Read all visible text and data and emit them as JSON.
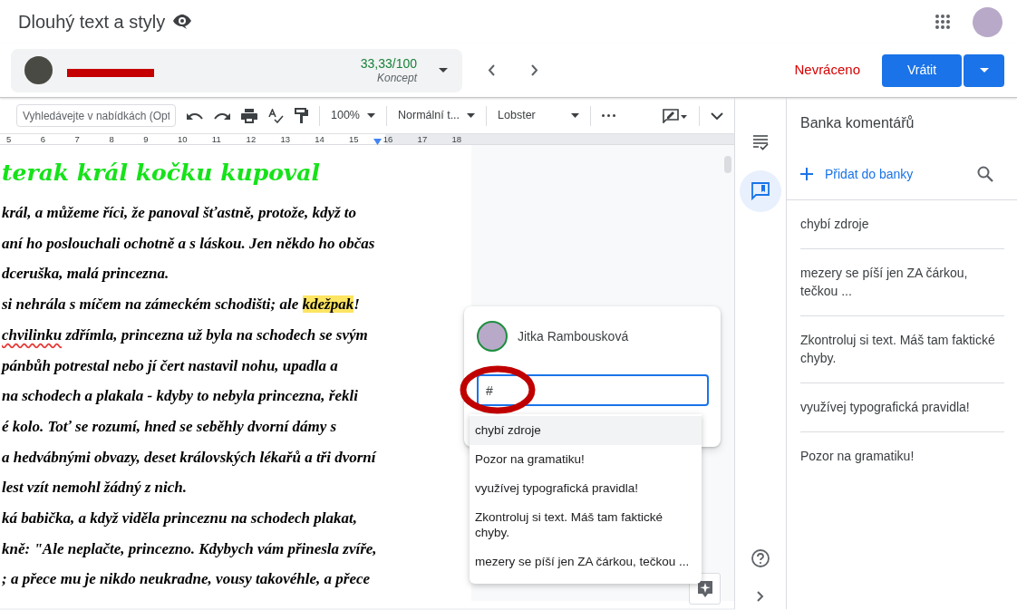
{
  "document": {
    "title": "Dlouhý text a styly"
  },
  "student": {
    "grade": "33,33/100",
    "status": "Koncept"
  },
  "return_status": "Nevráceno",
  "return_button": "Vrátit",
  "toolbar": {
    "search_placeholder": "Vyhledávejte v nabídkách (Opt",
    "zoom": "100%",
    "style": "Normální t...",
    "font": "Lobster"
  },
  "ruler": {
    "labels": [
      "5",
      "6",
      "7",
      "8",
      "9",
      "10",
      "11",
      "12",
      "13",
      "14",
      "15",
      "16",
      "17",
      "18"
    ]
  },
  "doc": {
    "heading": "terak král kočku kupoval",
    "lines": [
      {
        "text": "král, a můžeme říci, že panoval šťastně, protože, když to"
      },
      {
        "text": "aní ho poslouchali ochotně a s láskou. Jen někdo ho občas"
      },
      {
        "text": "dceruška, malá princezna."
      },
      {
        "parts": [
          {
            "text": "si nehrála s míčem na zámeckém schodišti; ale ",
            "highlighted": false
          },
          {
            "text": "kdežpak",
            "highlighted": true
          },
          {
            "text": "!",
            "highlighted": false
          }
        ]
      },
      {
        "parts": [
          {
            "text": "chvilinku",
            "misspelled": true
          },
          {
            "text": " zdřímla, princezna už byla na schodech se svým",
            "misspelled": false
          }
        ]
      },
      {
        "text": "pánbůh potrestal nebo jí čert nastavil nohu, upadla a"
      },
      {
        "text": "na schodech a plakala - kdyby to nebyla princezna, řekli"
      },
      {
        "text": "é kolo. Toť se rozumí, hned se seběhly dvorní dámy s"
      },
      {
        "text": "a hedvábnými obvazy, deset královských lékařů a tři dvorní"
      },
      {
        "text": "lest vzít nemohl žádný z nich."
      },
      {
        "text": "ká babička, a když viděla princeznu na schodech plakat,"
      },
      {
        "text": "kně: \"Ale neplačte, princezno. Kdybych vám přinesla zvíře,"
      },
      {
        "text": "; a přece mu je nikdo neukradne, vousy takovéhle, a přece"
      }
    ]
  },
  "comment": {
    "author": "Jitka Rambousková",
    "value": "#",
    "suggestions": [
      {
        "text": "chybí zdroje",
        "selected": true
      },
      {
        "text": "Pozor na gramatiku!",
        "selected": false
      },
      {
        "text": "využívej typografická pravidla!",
        "selected": false
      },
      {
        "text": "Zkontroluj si text. Máš tam faktické chyby.",
        "selected": false
      },
      {
        "text": "mezery se píší jen ZA čárkou, tečkou ...",
        "selected": false
      }
    ]
  },
  "rail": [
    {
      "kind": "checklist",
      "selected": false
    },
    {
      "kind": "comment-bank",
      "selected": true
    }
  ],
  "panel": {
    "title": "Banka komentářů",
    "add": "Přidat do banky",
    "items": [
      "chybí zdroje",
      "mezery se píší jen ZA čárkou, tečkou ...",
      "Zkontroluj si text. Máš tam faktické chyby.",
      "využívej typografická pravidla!",
      "Pozor na gramatiku!"
    ]
  }
}
